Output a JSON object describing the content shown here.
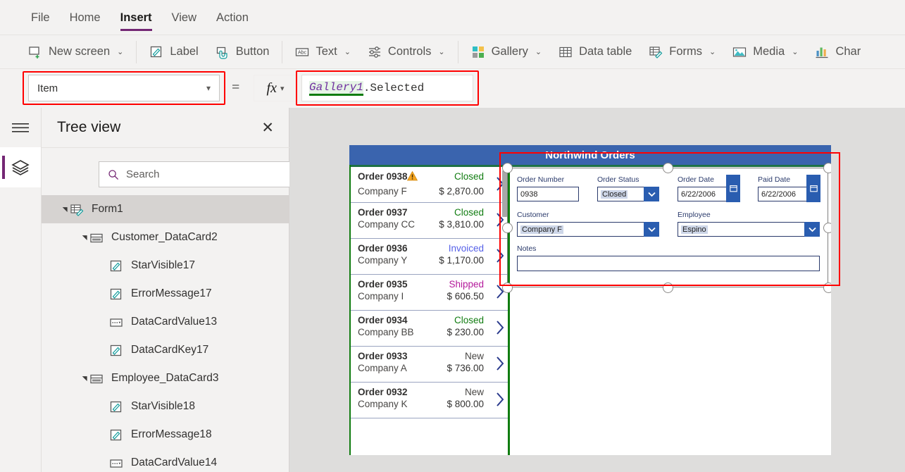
{
  "menubar": {
    "items": [
      {
        "label": "File",
        "active": false
      },
      {
        "label": "Home",
        "active": false
      },
      {
        "label": "Insert",
        "active": true
      },
      {
        "label": "View",
        "active": false
      },
      {
        "label": "Action",
        "active": false
      }
    ]
  },
  "ribbon": {
    "items": [
      {
        "label": "New screen",
        "icon": "new-screen-icon",
        "caret": true
      },
      {
        "label": "Label",
        "icon": "label-icon",
        "caret": false
      },
      {
        "label": "Button",
        "icon": "button-icon",
        "caret": false
      },
      {
        "label": "Text",
        "icon": "text-icon",
        "caret": true
      },
      {
        "label": "Controls",
        "icon": "controls-icon",
        "caret": true
      },
      {
        "label": "Gallery",
        "icon": "gallery-icon",
        "caret": true
      },
      {
        "label": "Data table",
        "icon": "data-table-icon",
        "caret": false
      },
      {
        "label": "Forms",
        "icon": "forms-icon",
        "caret": true
      },
      {
        "label": "Media",
        "icon": "media-icon",
        "caret": true
      },
      {
        "label": "Char",
        "icon": "charts-icon",
        "caret": false
      }
    ]
  },
  "formula_bar": {
    "property": "Item",
    "equals": "=",
    "fx_label": "fx",
    "formula_identifier": "Gallery1",
    "formula_rest": ".Selected"
  },
  "tree_panel": {
    "title": "Tree view",
    "close_label": "✕",
    "search_placeholder": "Search",
    "items": [
      {
        "label": "Form1",
        "depth": 0,
        "caret": "▾",
        "icon": "form-icon",
        "selected": true
      },
      {
        "label": "Customer_DataCard2",
        "depth": 1,
        "caret": "▾",
        "icon": "datacard-icon",
        "selected": false
      },
      {
        "label": "StarVisible17",
        "depth": 2,
        "caret": "",
        "icon": "label-control-icon",
        "selected": false
      },
      {
        "label": "ErrorMessage17",
        "depth": 2,
        "caret": "",
        "icon": "label-control-icon",
        "selected": false
      },
      {
        "label": "DataCardValue13",
        "depth": 2,
        "caret": "",
        "icon": "dropdown-control-icon",
        "selected": false
      },
      {
        "label": "DataCardKey17",
        "depth": 2,
        "caret": "",
        "icon": "label-control-icon",
        "selected": false
      },
      {
        "label": "Employee_DataCard3",
        "depth": 1,
        "caret": "▾",
        "icon": "datacard-icon",
        "selected": false
      },
      {
        "label": "StarVisible18",
        "depth": 2,
        "caret": "",
        "icon": "label-control-icon",
        "selected": false
      },
      {
        "label": "ErrorMessage18",
        "depth": 2,
        "caret": "",
        "icon": "label-control-icon",
        "selected": false
      },
      {
        "label": "DataCardValue14",
        "depth": 2,
        "caret": "",
        "icon": "dropdown-control-icon",
        "selected": false
      }
    ]
  },
  "canvas": {
    "app_title": "Northwind Orders",
    "gallery": {
      "rows": [
        {
          "order": "Order 0938",
          "company": "Company F",
          "status": "Closed",
          "status_color": "#107c10",
          "amount": "$ 2,870.00",
          "warning": true
        },
        {
          "order": "Order 0937",
          "company": "Company CC",
          "status": "Closed",
          "status_color": "#107c10",
          "amount": "$ 3,810.00",
          "warning": false
        },
        {
          "order": "Order 0936",
          "company": "Company Y",
          "status": "Invoiced",
          "status_color": "#5560e8",
          "amount": "$ 1,170.00",
          "warning": false
        },
        {
          "order": "Order 0935",
          "company": "Company I",
          "status": "Shipped",
          "status_color": "#b4199b",
          "amount": "$ 606.50",
          "warning": false
        },
        {
          "order": "Order 0934",
          "company": "Company BB",
          "status": "Closed",
          "status_color": "#107c10",
          "amount": "$ 230.00",
          "warning": false
        },
        {
          "order": "Order 0933",
          "company": "Company A",
          "status": "New",
          "status_color": "#484644",
          "amount": "$ 736.00",
          "warning": false
        },
        {
          "order": "Order 0932",
          "company": "Company K",
          "status": "New",
          "status_color": "#484644",
          "amount": "$ 800.00",
          "warning": false
        }
      ]
    },
    "form": {
      "fields": [
        {
          "label": "Order Number",
          "value": "0938",
          "type": "text",
          "highlight": false
        },
        {
          "label": "Order Status",
          "value": "Closed",
          "type": "dropdown",
          "highlight": true
        },
        {
          "label": "Order Date",
          "value": "6/22/2006",
          "type": "date",
          "highlight": false
        },
        {
          "label": "Paid Date",
          "value": "6/22/2006",
          "type": "date",
          "highlight": false
        },
        {
          "label": "Customer",
          "value": "Company F",
          "type": "dropdown",
          "highlight": true
        },
        {
          "label": "Employee",
          "value": "Espino",
          "type": "dropdown",
          "highlight": true
        },
        {
          "label": "Notes",
          "value": "",
          "type": "text",
          "highlight": false
        }
      ]
    }
  },
  "colors": {
    "accent_purple": "#742774",
    "annotation_red": "#ff0000",
    "app_header_blue": "#3a64ae",
    "selection_green": "#107c10",
    "chrome_gray": "#f3f2f1",
    "canvas_gray": "#dedddc"
  }
}
